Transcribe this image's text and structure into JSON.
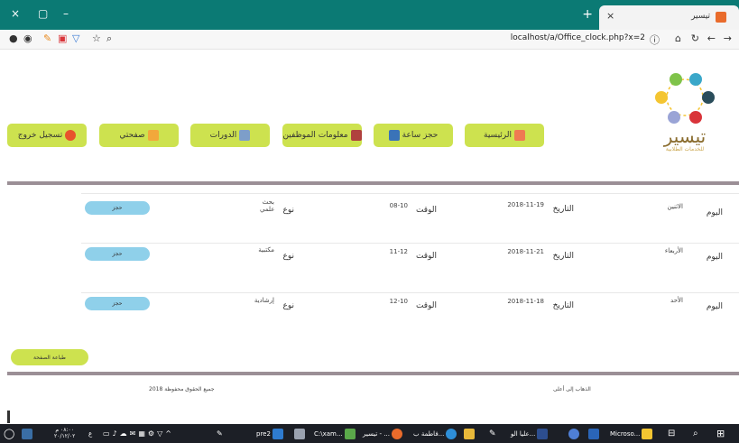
{
  "browser": {
    "tab_title": "تيسير",
    "url": "localhost/a/Office_clock.php?x=2",
    "window_controls": [
      "×",
      "▢",
      "–"
    ],
    "new_tab": "+",
    "tab_close": "×"
  },
  "nav": {
    "home": "الرئيسية",
    "book_hour": "حجز ساعة",
    "staff_info": "معلومات الموظفين",
    "courses": "الدورات",
    "my_page": "صفحتي",
    "logout": "تسجيل خروج"
  },
  "logo": {
    "title": "تيسير",
    "subtitle": "للخدمات الطلابية",
    "colors": [
      "#7fc34a",
      "#3aa7c9",
      "#2a4d5b",
      "#d9343a",
      "#9aa4d6",
      "#f4c531"
    ]
  },
  "appointments": [
    {
      "day_label": "اليوم",
      "day": "الاثنين",
      "date_label": "التاريخ",
      "date": "2018-11-19",
      "time_label": "الوقت",
      "time": "08-10",
      "type_label": "نوع",
      "type": "بحث علمي",
      "book": "حجز"
    },
    {
      "day_label": "اليوم",
      "day": "الأربعاء",
      "date_label": "التاريخ",
      "date": "2018-11-21",
      "time_label": "الوقت",
      "time": "11-12",
      "type_label": "نوع",
      "type": "مكتبية",
      "book": "حجز"
    },
    {
      "day_label": "اليوم",
      "day": "الأحد",
      "date_label": "التاريخ",
      "date": "2018-11-18",
      "time_label": "الوقت",
      "time": "12-10",
      "type_label": "نوع",
      "type": "إرشادية",
      "book": "حجز"
    }
  ],
  "print_button": "طباعة الصفحة",
  "footer": {
    "left": "جميع الحقوق محفوظة 2018",
    "right": "الذهاب إلى أعلى"
  },
  "taskbar": {
    "clock_time": "٠٨:٠٠ م",
    "clock_date": "٢٠/١٢/٠٢",
    "lang": "ع",
    "items": [
      "Microso...",
      "عليا الو...",
      "فاطمة ب...",
      "تيسير - ...",
      "C:\\xam...",
      "pre2"
    ]
  }
}
